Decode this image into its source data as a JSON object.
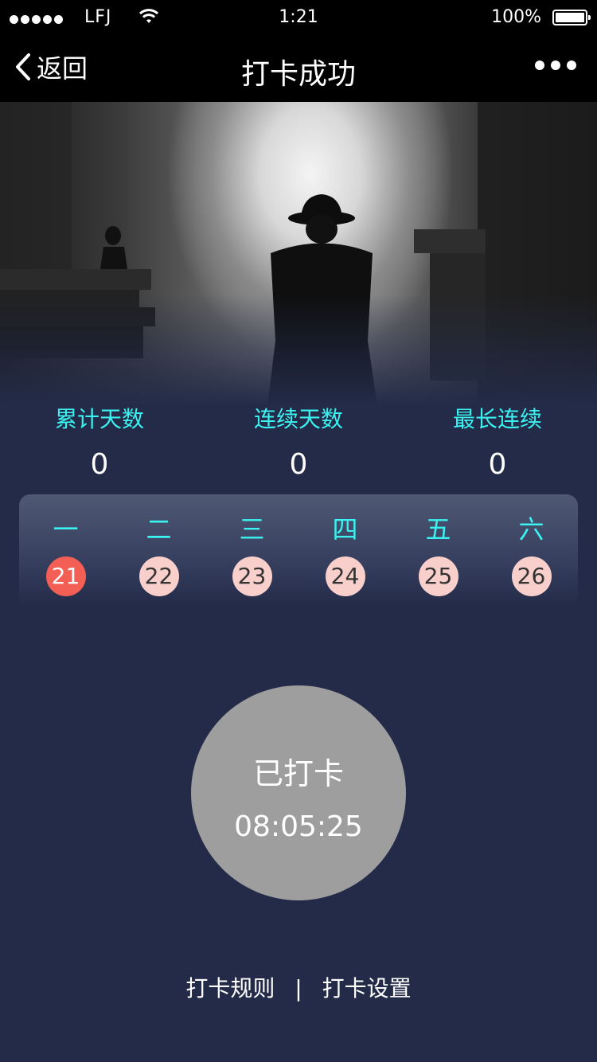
{
  "status_bar": {
    "carrier": "LFJ",
    "time": "1:21",
    "battery": "100%"
  },
  "nav": {
    "back_label": "返回",
    "title": "打卡成功"
  },
  "stats": [
    {
      "label": "累计天数",
      "value": "0"
    },
    {
      "label": "连续天数",
      "value": "0"
    },
    {
      "label": "最长连续",
      "value": "0"
    }
  ],
  "week": {
    "days": [
      {
        "name": "一",
        "date": "21",
        "active": true
      },
      {
        "name": "二",
        "date": "22",
        "active": false
      },
      {
        "name": "三",
        "date": "23",
        "active": false
      },
      {
        "name": "四",
        "date": "24",
        "active": false
      },
      {
        "name": "五",
        "date": "25",
        "active": false
      },
      {
        "name": "六",
        "date": "26",
        "active": false
      }
    ]
  },
  "checkin": {
    "status": "已打卡",
    "time": "08:05:25"
  },
  "footer": {
    "rules_label": "打卡规则",
    "separator": "|",
    "settings_label": "打卡设置"
  },
  "colors": {
    "background": "#232b48",
    "accent_cyan": "#3cf2f0",
    "active_date": "#f35e55",
    "inactive_date": "#f8cfcb",
    "checkin_circle": "#9e9e9e"
  }
}
